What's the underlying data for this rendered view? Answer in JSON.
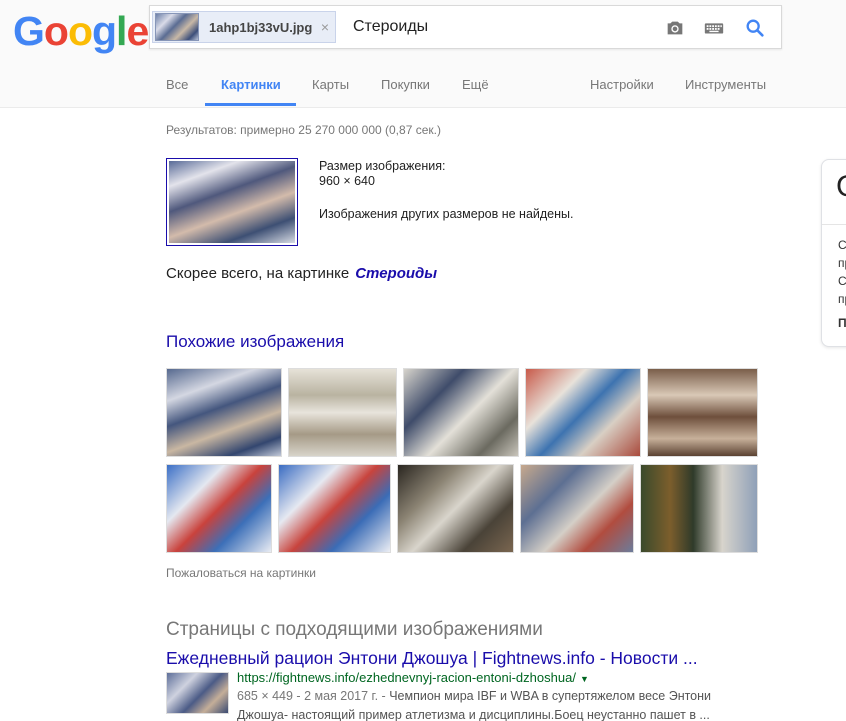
{
  "logo": {
    "letters": [
      "G",
      "o",
      "o",
      "g",
      "l",
      "e"
    ],
    "colors": [
      "#4285f4",
      "#ea4335",
      "#fbbc05",
      "#4285f4",
      "#34a853",
      "#ea4335"
    ]
  },
  "search": {
    "file_chip": "1ahp1bj33vU.jpg",
    "close_glyph": "×",
    "query": "Стероиды",
    "icons": [
      "camera-icon",
      "keyboard-icon",
      "search-icon"
    ],
    "accent": "#4285f4"
  },
  "tabs": [
    {
      "label": "Все"
    },
    {
      "label": "Картинки",
      "active": true
    },
    {
      "label": "Карты"
    },
    {
      "label": "Покупки"
    },
    {
      "label": "Ещё"
    },
    {
      "label": "Настройки"
    },
    {
      "label": "Инструменты"
    }
  ],
  "stats": "Результатов: примерно 25 270 000 000 (0,87 сек.)",
  "image_info": {
    "size_label": "Размер изображения:",
    "size_value": "960 × 640",
    "no_other_sizes": "Изображения других размеров не найдены."
  },
  "best_guess": {
    "prefix": "Скорее всего, на картинке",
    "link": "Стероиды"
  },
  "similar": {
    "title": "Похожие изображения",
    "report": "Пожаловаться на картинки"
  },
  "pages": {
    "title": "Страницы с подходящими изображениями",
    "result": {
      "title": "Ежедневный рацион Энтони Джошуа | Fightnews.info - Новости ...",
      "url": "https://fightnews.info/ezhednevnyj-racion-entoni-dzhoshua/",
      "caret": "▼",
      "meta": "685 × 449 - 2 мая 2017 г. - ",
      "snippet_1": "Чемпион мира IBF и WBA в супертяжелом весе Энтони",
      "snippet_2": "Джошуа- настоящий пример атлетизма и дисциплины.Боец неустанно пашет в ..."
    }
  },
  "knowledge_panel": {
    "big_letter": "С",
    "lines": [
      "С",
      "пр",
      "С",
      "пр"
    ],
    "bold_line": "П"
  }
}
